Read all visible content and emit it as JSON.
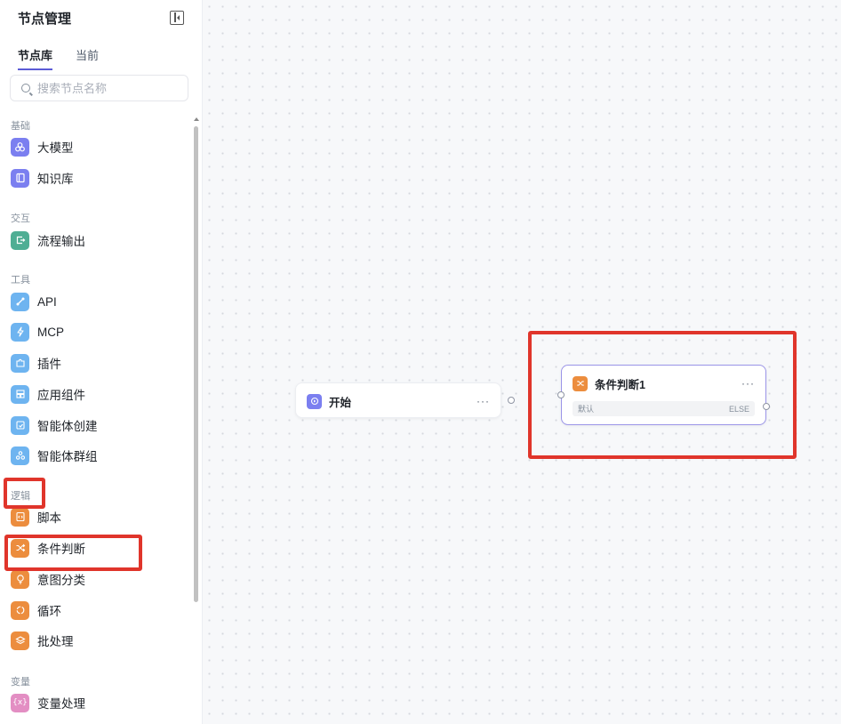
{
  "sidebar": {
    "title": "节点管理",
    "tabs": [
      {
        "label": "节点库",
        "active": true
      },
      {
        "label": "当前",
        "active": false
      }
    ],
    "search_placeholder": "搜索节点名称",
    "groups": [
      {
        "title": "基础",
        "items": [
          {
            "label": "大模型",
            "icon": "llm-icon",
            "color": "#7b7ff0"
          },
          {
            "label": "知识库",
            "icon": "book-icon",
            "color": "#7b7ff0"
          }
        ]
      },
      {
        "title": "交互",
        "items": [
          {
            "label": "流程输出",
            "icon": "output-icon",
            "color": "#4fae94"
          }
        ]
      },
      {
        "title": "工具",
        "items": [
          {
            "label": "API",
            "icon": "link-icon",
            "color": "#6eb4f0"
          },
          {
            "label": "MCP",
            "icon": "lightning-icon",
            "color": "#6eb4f0"
          },
          {
            "label": "插件",
            "icon": "puzzle-icon",
            "color": "#6eb4f0"
          },
          {
            "label": "应用组件",
            "icon": "component-icon",
            "color": "#6eb4f0"
          },
          {
            "label": "智能体创建",
            "icon": "agent-create-icon",
            "color": "#6eb4f0"
          },
          {
            "label": "智能体群组",
            "icon": "agent-group-icon",
            "color": "#6eb4f0"
          }
        ]
      },
      {
        "title": "逻辑",
        "items": [
          {
            "label": "脚本",
            "icon": "script-icon",
            "color": "#ec8d3e"
          },
          {
            "label": "条件判断",
            "icon": "shuffle-icon",
            "color": "#ec8d3e"
          },
          {
            "label": "意图分类",
            "icon": "bulb-icon",
            "color": "#ec8d3e"
          },
          {
            "label": "循环",
            "icon": "loop-icon",
            "color": "#ec8d3e"
          },
          {
            "label": "批处理",
            "icon": "layers-icon",
            "color": "#ec8d3e"
          }
        ]
      },
      {
        "title": "变量",
        "items": [
          {
            "label": "变量处理",
            "icon": "variable-icon",
            "color": "#e38ec3"
          }
        ]
      }
    ]
  },
  "canvas": {
    "start_node": {
      "title": "开始",
      "more": "···",
      "icon": "start-icon",
      "color": "#7b7ff0"
    },
    "condition_node": {
      "title": "条件判断1",
      "more": "···",
      "icon": "shuffle-icon",
      "color": "#ec8d3e",
      "branch_left": "默认",
      "branch_right": "ELSE",
      "border_color": "#9b95e8"
    }
  },
  "annotation_color": "#e0352b"
}
